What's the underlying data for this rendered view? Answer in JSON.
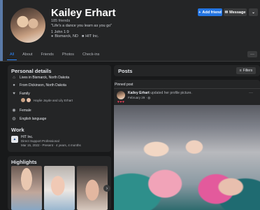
{
  "profile": {
    "name": "Kailey Erhart",
    "friends": "185 friends",
    "bio": "\"Life's a dance you learn as you go\"",
    "bible": "1 John 1:9",
    "location": "Bismarck, ND",
    "work": "HIT Inc."
  },
  "actions": {
    "add_friend": "Add friend",
    "message": "Message",
    "more": "⌄"
  },
  "tabs": [
    "All",
    "About",
    "Friends",
    "Photos",
    "Check-ins"
  ],
  "tabs_more": "···",
  "personal_details": {
    "title": "Personal details",
    "lives_in": "Lives in Bismarck, North Dakota",
    "from": "From Dickinson, North Dakota",
    "family_label": "Family",
    "family_members": "Haylie Jayde and Lily Erhart",
    "gender": "Female",
    "language": "English language",
    "work_title": "Work",
    "employer": "HIT Inc.",
    "job_title": "Direct Support Professional",
    "job_dates": "Mar 15, 2022 - Present · 4 years, 4 months"
  },
  "highlights": {
    "title": "Highlights",
    "next": "›"
  },
  "posts": {
    "title": "Posts",
    "filters": "Filters",
    "pinned_label": "Pinned post",
    "author": "Kailey Erhart",
    "action_text": "updated her profile picture.",
    "date": "February 29 · ",
    "reactions": "♥♥♥",
    "more": "···"
  },
  "colors": {
    "accent": "#2374e1",
    "panel": "#242526",
    "bg": "#18191a"
  }
}
